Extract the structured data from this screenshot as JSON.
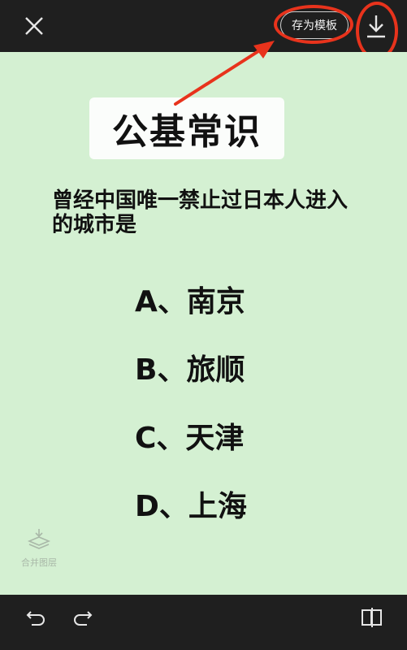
{
  "toolbar": {
    "save_template_label": "存为模板",
    "close_icon": "close-icon",
    "download_icon": "download-icon"
  },
  "canvas": {
    "title": "公基常识",
    "question": "曾经中国唯一禁止过日本人进入的城市是",
    "options": [
      "A、南京",
      "B、旅顺",
      "C、天津",
      "D、上海"
    ],
    "merge_layers_label": "合并图层"
  },
  "bottom": {
    "undo_icon": "undo-icon",
    "redo_icon": "redo-icon",
    "compare_icon": "compare-icon"
  },
  "colors": {
    "annotation_red": "#e8331c",
    "canvas_green": "#d4f0d2",
    "bar_dark": "#1f1f1f"
  }
}
